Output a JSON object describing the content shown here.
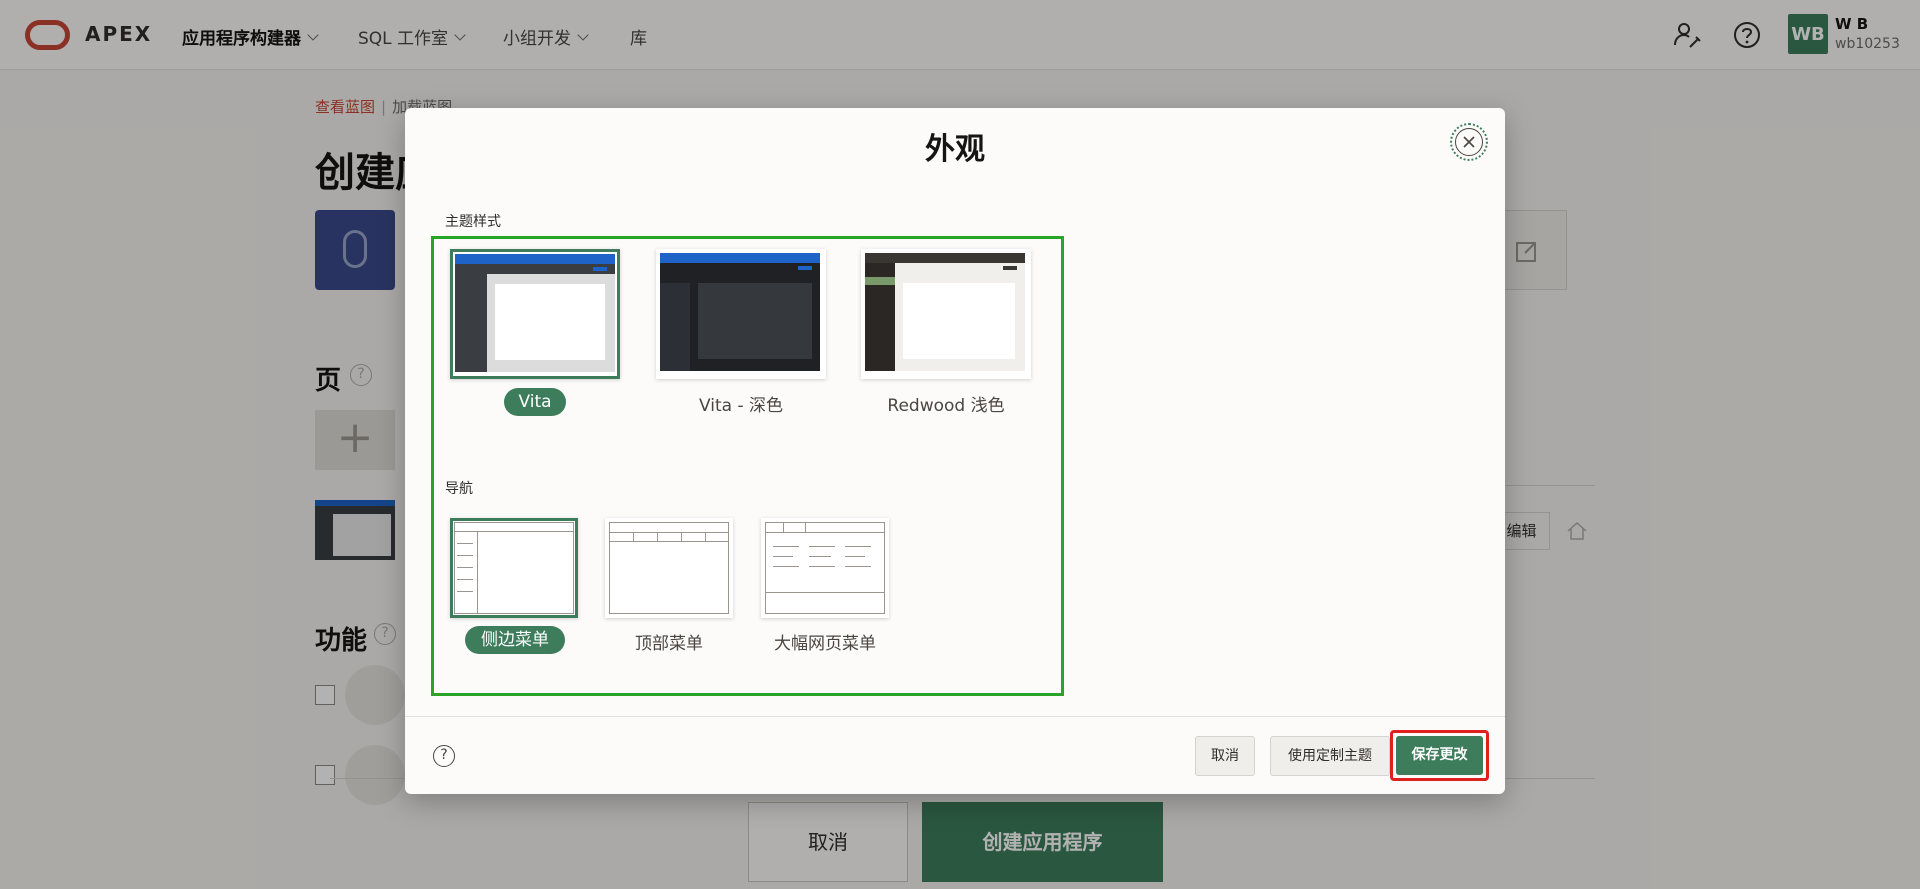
{
  "topbar": {
    "logo": "APEX",
    "nav": [
      {
        "label": "应用程序构建器"
      },
      {
        "label": "SQL 工作室"
      },
      {
        "label": "小组开发"
      },
      {
        "label": "库"
      }
    ],
    "user": {
      "initials": "WB",
      "name": "W B",
      "id": "wb10253"
    }
  },
  "background": {
    "breadcrumb": [
      "查看蓝图",
      "加载蓝图"
    ],
    "heading": "创建应",
    "pages_title": "页",
    "features_title": "功能",
    "edit_label": "编辑",
    "cancel_label": "取消",
    "create_label": "创建应用程序"
  },
  "dialog": {
    "title": "外观",
    "theme_style_label": "主题样式",
    "themes": [
      {
        "label": "Vita",
        "selected": true
      },
      {
        "label": "Vita - 深色",
        "selected": false
      },
      {
        "label": "Redwood 浅色",
        "selected": false
      }
    ],
    "navigation_label": "导航",
    "navigation_options": [
      {
        "label": "侧边菜单",
        "selected": true
      },
      {
        "label": "顶部菜单",
        "selected": false
      },
      {
        "label": "大幅网页菜单",
        "selected": false
      }
    ],
    "buttons": {
      "cancel": "取消",
      "custom_theme": "使用定制主题",
      "save": "保存更改"
    },
    "colors": {
      "accent": "#3d7d5c",
      "highlight_frame": "#28a428",
      "save_highlight": "#e0201c"
    }
  }
}
